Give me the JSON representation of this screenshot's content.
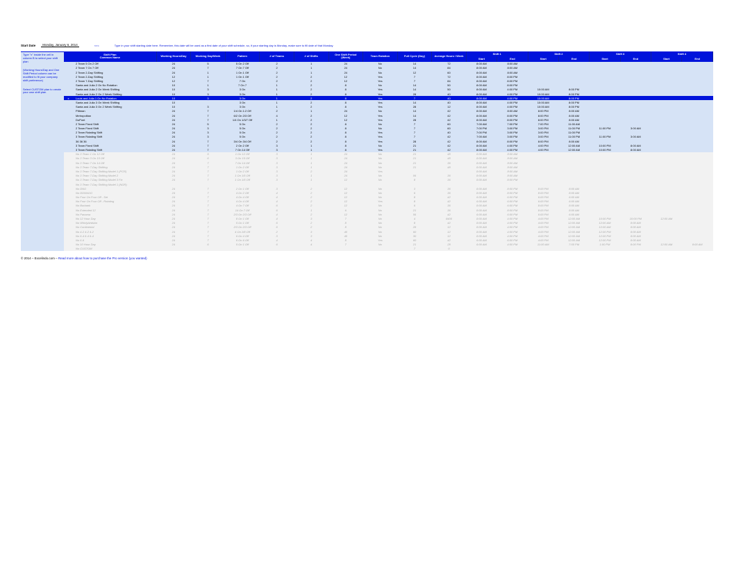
{
  "top": {
    "start_label": "Start Date",
    "start_date": "Monday, January 6, 2014",
    "arrow": "<<<",
    "note": "Type in your shift starting date here. Remember, this date will be used as a first date of your shift schedule, so, if your starting day is Monday, make sure to fill date of that Monday."
  },
  "headers": {
    "shift_plan": "Shift Plan",
    "common_name": "Common Name",
    "working_hours_day": "Working Hours/Day",
    "working_day_week": "Working Day/Week",
    "pattern": "Pattern",
    "no_teams": "# of Teams",
    "no_shifts": "# of Shifts",
    "one_shift_period": "One Shift Period (Week)",
    "team_rotation": "Team Rotation",
    "full_cycle": "Full Cycle (Day)",
    "avg_hours_week": "Average Hours / Week",
    "shift1": "Shift 1",
    "shift2": "Shift 2",
    "shift3": "Shift 3",
    "shift4": "Shift 4",
    "start": "Start",
    "end": "End"
  },
  "sidebar": {
    "note1": "Type \"x\" inside the cell in column B to select your shift plan",
    "note2": "(Working Hours/Day and One Shift Period column can be modified to fit your company shift preference)",
    "note3": "Select CUSTOM plan to create your own shift plan"
  },
  "rows": [
    {
      "sel": "",
      "name": "2 Team 5 On 2 Off",
      "whd": "24",
      "wdw": "5",
      "pat": "5 On 2 Off",
      "teams": "2",
      "shifts": "1",
      "period": "24",
      "rot": "No",
      "cycle": "14",
      "avg": "72",
      "s": [
        [
          "8:00 AM",
          "8:00 AM"
        ]
      ]
    },
    {
      "sel": "",
      "name": "2 Team 7 On 7 Off",
      "whd": "24",
      "wdw": "7",
      "pat": "7 On 7 Off",
      "teams": "2",
      "shifts": "1",
      "period": "24",
      "rot": "No",
      "cycle": "14",
      "avg": "84",
      "s": [
        [
          "8:00 AM",
          "8:00 AM"
        ]
      ]
    },
    {
      "sel": "",
      "name": "2 Team 2-Day Shifting",
      "whd": "24",
      "wdw": "1",
      "pat": "1 On 1 Off",
      "teams": "2",
      "shifts": "1",
      "period": "24",
      "rot": "No",
      "cycle": "12",
      "avg": "60",
      "s": [
        [
          "8:00 AM",
          "8:00 AM"
        ]
      ]
    },
    {
      "sel": "",
      "name": "2 Team 2-Day Shifting",
      "whd": "12",
      "wdw": "1",
      "pat": "1 On 1 Off",
      "teams": "2",
      "shifts": "2",
      "period": "12",
      "rot": "Yes",
      "cycle": "7",
      "avg": "72",
      "s": [
        [
          "8:00 AM",
          "8:00 PM"
        ]
      ]
    },
    {
      "sel": "",
      "name": "2 Team 7-Day Shifting",
      "whd": "12",
      "wdw": "7",
      "pat": "7 On",
      "teams": "2",
      "shifts": "2",
      "period": "12",
      "rot": "Yes",
      "cycle": "7",
      "avg": "84",
      "s": [
        [
          "8:00 AM",
          "8:00 PM"
        ]
      ]
    },
    {
      "sel": "",
      "name": "Santa and Julia 2 On No Rotation",
      "whd": "10",
      "wdw": "1",
      "pat": "7 On 7",
      "teams": "1",
      "shifts": "2",
      "period": "8",
      "rot": "No",
      "cycle": "14",
      "avg": "50",
      "s": [
        [
          "8:00 AM",
          "8:00 PM"
        ]
      ]
    },
    {
      "sel": "",
      "name": "Santa and Julia 2 On Week Shifting",
      "whd": "10",
      "wdw": "3",
      "pat": "3 On",
      "teams": "1",
      "shifts": "2",
      "period": "8",
      "rot": "Yes",
      "cycle": "14",
      "avg": "50",
      "s": [
        [
          "8:00 AM",
          "4:00 PM"
        ],
        [
          "10:00 AM",
          "8:00 PM"
        ]
      ]
    },
    {
      "sel": "",
      "name": "Santa and Julia 2 On 2 Week Shifting",
      "whd": "10",
      "wdw": "3",
      "pat": "3 On",
      "teams": "1",
      "shifts": "2",
      "period": "8",
      "rot": "Yes",
      "cycle": "28",
      "avg": "40",
      "s": [
        [
          "8:00 AM",
          "4:00 PM"
        ],
        [
          "10:00 AM",
          "8:00 PM"
        ]
      ]
    },
    {
      "sel": "x",
      "name": "Louis and Julia 1 On No Rotation",
      "whd": "10",
      "wdw": "3",
      "pat": "3 On",
      "teams": "1",
      "shifts": "2",
      "period": "8",
      "rot": "Yes",
      "cycle": "7",
      "avg": "40",
      "s": [
        [
          "8:00 AM",
          "4:00 PM"
        ],
        [
          "10:00 AM",
          "8:00 PM"
        ]
      ],
      "selected": true
    },
    {
      "sel": "",
      "name": "Santa and Julia 3 On Week Shifting",
      "whd": "10",
      "wdw": "",
      "pat": "3 On",
      "teams": "1",
      "shifts": "2",
      "period": "8",
      "rot": "Yes",
      "cycle": "14",
      "avg": "40",
      "s": [
        [
          "8:00 AM",
          "4:00 PM"
        ],
        [
          "10:00 AM",
          "8:00 PM"
        ]
      ]
    },
    {
      "sel": "",
      "name": "Santa and Julia 3 On 2 Week Shifting",
      "whd": "10",
      "wdw": "3",
      "pat": "3 On",
      "teams": "1",
      "shifts": "2",
      "period": "8",
      "rot": "Yes",
      "cycle": "28",
      "avg": "12",
      "s": [
        [
          "8:00 AM",
          "4:00 PM"
        ],
        [
          "10:00 AM",
          "8:00 PM"
        ]
      ]
    },
    {
      "sel": "",
      "name": "Pittman",
      "whd": "24",
      "wdw": "7",
      "pat": "1/4 On 1:2 Off",
      "teams": "2",
      "shifts": "1",
      "period": "24",
      "rot": "No",
      "cycle": "14",
      "avg": "42",
      "s": [
        [
          "8:00 AM",
          "8:00 AM"
        ],
        [
          "8:00 PM",
          "8:00 AM"
        ]
      ]
    },
    {
      "sel": "",
      "name": "Metropolitan",
      "whd": "24",
      "wdw": "7",
      "pat": "6/2 On 2/3 Off",
      "teams": "4",
      "shifts": "2",
      "period": "12",
      "rot": "Yes",
      "cycle": "14",
      "avg": "42",
      "s": [
        [
          "8:00 AM",
          "8:00 PM"
        ],
        [
          "8:00 PM",
          "8:00 AM"
        ]
      ]
    },
    {
      "sel": "",
      "name": "DuPont",
      "whd": "24",
      "wdw": "7",
      "pat": "1/4 On 1/3/7 Off",
      "teams": "1",
      "shifts": "2",
      "period": "12",
      "rot": "Yes",
      "cycle": "28",
      "avg": "42",
      "s": [
        [
          "8:00 AM",
          "8:00 PM"
        ],
        [
          "8:00 PM",
          "8:00 AM"
        ]
      ]
    },
    {
      "sel": "",
      "name": "2 Team Fixed Shift",
      "whd": "24",
      "wdw": "5",
      "pat": "5 On",
      "teams": "2",
      "shifts": "2",
      "period": "8",
      "rot": "No",
      "cycle": "7",
      "avg": "60",
      "s": [
        [
          "7:00 AM",
          "7:00 PM"
        ],
        [
          "7:00 PM",
          "11:00 AM"
        ]
      ]
    },
    {
      "sel": "",
      "name": "2 Team Fixed Shift",
      "whd": "24",
      "wdw": "3",
      "pat": "5 On",
      "teams": "2",
      "shifts": "2",
      "period": "8",
      "rot": "No",
      "cycle": "7",
      "avg": "60",
      "s": [
        [
          "7:00 PM",
          "3:00 PM"
        ],
        [
          "3:00 PM",
          "11:00 PM"
        ],
        [
          "11:00 PM",
          "3:00 AM"
        ]
      ]
    },
    {
      "sel": "",
      "name": "2 Team Rotating Shift",
      "whd": "24",
      "wdw": "3",
      "pat": "5 On",
      "teams": "2",
      "shifts": "2",
      "period": "8",
      "rot": "Yes",
      "cycle": "7",
      "avg": "40",
      "s": [
        [
          "7:00 PM",
          "3:00 PM"
        ],
        [
          "3:00 PM",
          "11:00 PM"
        ]
      ]
    },
    {
      "sel": "",
      "name": "3 Team Rotating Shift",
      "whd": "24",
      "wdw": "3",
      "pat": "5 On",
      "teams": "2",
      "shifts": "2",
      "period": "8",
      "rot": "Yes",
      "cycle": "7",
      "avg": "42",
      "s": [
        [
          "7:00 AM",
          "3:00 PM"
        ],
        [
          "3:00 PM",
          "11:00 PM"
        ],
        [
          "11:00 PM",
          "3:00 AM"
        ]
      ]
    },
    {
      "sel": "",
      "name": "36 36 36",
      "whd": "24",
      "wdw": "7",
      "pat": "3/4 On 3/4 Off",
      "teams": "2",
      "shifts": "2",
      "period": "8",
      "rot": "Yes",
      "cycle": "28",
      "avg": "42",
      "s": [
        [
          "8:00 AM",
          "8:00 PM"
        ],
        [
          "8:00 PM",
          "8:00 AM"
        ]
      ]
    },
    {
      "sel": "",
      "name": "3 Team Fixed Shift",
      "whd": "24",
      "wdw": "7",
      "pat": "2 On 2 Off",
      "teams": "3",
      "shifts": "1",
      "period": "8",
      "rot": "No",
      "cycle": "21",
      "avg": "42",
      "s": [
        [
          "8:00 AM",
          "4:00 PM"
        ],
        [
          "4:00 PM",
          "12:00 AM"
        ],
        [
          "10:00 PM",
          "8:00 AM"
        ]
      ]
    },
    {
      "sel": "",
      "name": "3 Team Rotating Shift",
      "whd": "24",
      "wdw": "7",
      "pat": "7 On 14 Off",
      "teams": "3",
      "shifts": "1",
      "period": "8",
      "rot": "Yes",
      "cycle": "21",
      "avg": "42",
      "s": [
        [
          "8:00 AM",
          "4:00 PM"
        ],
        [
          "4:00 PM",
          "12:00 AM"
        ],
        [
          "10:00 PM",
          "8:00 AM"
        ]
      ]
    }
  ],
  "inactive_rows": [
    {
      "name": "No  3 Team 1 On 12 Off",
      "whd": "24",
      "wdw": "5",
      "pat": "1 On 12 Off",
      "teams": "3",
      "shifts": "1",
      "period": "24",
      "rot": "No",
      "cycle": "21",
      "avg": "48",
      "s": [
        [
          "8:00 AM",
          "8:00 AM"
        ]
      ]
    },
    {
      "name": "No  3 Team 3 On 15 Off",
      "whd": "24",
      "wdw": "6",
      "pat": "3 On 15 Off",
      "teams": "3",
      "shifts": "1",
      "period": "24",
      "rot": "No",
      "cycle": "21",
      "avg": "48",
      "s": [
        [
          "8:00 AM",
          "8:00 AM"
        ]
      ]
    },
    {
      "name": "No  3 Team 7 On 14 Off",
      "whd": "24",
      "wdw": "7",
      "pat": "7 On 14 Off",
      "teams": "3",
      "shifts": "1",
      "period": "24",
      "rot": "No",
      "cycle": "21",
      "avg": "36",
      "s": [
        [
          "8:00 AM",
          "8:00 AM"
        ]
      ]
    },
    {
      "name": "No  3 Team 7-Day Shifting",
      "whd": "24",
      "wdw": "7",
      "pat": "1 On 2 Off",
      "teams": "3",
      "shifts": "1",
      "period": "24",
      "rot": "No",
      "cycle": "21",
      "avg": "48",
      "s": [
        [
          "8:00 AM",
          "8:00 AM"
        ]
      ]
    },
    {
      "name": "No  3 Team 7-Day Shifting Model 1 (PCR)",
      "whd": "24",
      "wdw": "7",
      "pat": "1 On 2 Off",
      "teams": "3",
      "shifts": "2",
      "period": "24",
      "rot": "Yes",
      "cycle": "",
      "avg": "",
      "s": [
        [
          "8:00 AM",
          "8:00 AM"
        ]
      ]
    },
    {
      "name": "No  3 Team 7-Day Shifting Model 2",
      "whd": "24",
      "wdw": "7",
      "pat": "1 On 1/5 Off",
      "teams": "3",
      "shifts": "1",
      "period": "24",
      "rot": "No",
      "cycle": "06",
      "avg": "36",
      "s": [
        [
          "8:00 AM",
          "8:00 AM"
        ]
      ]
    },
    {
      "name": "No  3 Team 7-Day Shifting Model 3 Fix",
      "whd": "24",
      "wdw": "7",
      "pat": "1 On 1/5 Off",
      "teams": "3",
      "shifts": "1",
      "period": "12",
      "rot": "No",
      "cycle": "8",
      "avg": "36",
      "s": [
        [
          "8:00 AM",
          "8:00 PM"
        ]
      ]
    },
    {
      "name": "No  3 Team 7-Day Shifting Model 1 (NGR)",
      "whd": "",
      "wdw": "",
      "pat": "",
      "teams": "",
      "shifts": "",
      "period": "",
      "rot": "",
      "cycle": "",
      "avg": "",
      "s": [
        []
      ]
    },
    {
      "name": "No  DNO",
      "whd": "24",
      "wdw": "7",
      "pat": "2 On 1 Off",
      "teams": "3",
      "shifts": "2",
      "period": "12",
      "rot": "No",
      "cycle": "3",
      "avg": "36",
      "s": [
        [
          "8:00 AM",
          "8:00 PM"
        ],
        [
          "8:00 PM",
          "8:00 AM"
        ]
      ]
    },
    {
      "name": "No  DDNNOO",
      "whd": "24",
      "wdw": "7",
      "pat": "4 On 2 Off",
      "teams": "4",
      "shifts": "2",
      "period": "12",
      "rot": "No",
      "cycle": "6",
      "avg": "36",
      "s": [
        [
          "8:00 AM",
          "8:00 PM"
        ],
        [
          "8:00 PM",
          "8:00 AM"
        ]
      ]
    },
    {
      "name": "No   Four On Four Off - Set",
      "whd": "24",
      "wdw": "7",
      "pat": "4 On 4 Off",
      "teams": "4",
      "shifts": "2",
      "period": "12",
      "rot": "No",
      "cycle": "8",
      "avg": "42",
      "s": [
        [
          "6:00 AM",
          "6:00 PM"
        ],
        [
          "6:00 PM",
          "6:00 AM"
        ]
      ]
    },
    {
      "name": "No   Four On Four Off - Rotating",
      "whd": "24",
      "wdw": "7",
      "pat": "4 On 4 Off",
      "teams": "4",
      "shifts": "2",
      "period": "12",
      "rot": "Yes",
      "cycle": "8",
      "avg": "42",
      "s": [
        [
          "6:00 AM",
          "6:00 PM"
        ],
        [
          "6:00 PM",
          "6:00 AM"
        ]
      ]
    },
    {
      "name": "No   Burbank",
      "whd": "24",
      "wdw": "7",
      "pat": "4 On 7 Off",
      "teams": "6",
      "shifts": "2",
      "period": "12",
      "rot": "No",
      "cycle": "6",
      "avg": "36",
      "s": [
        [
          "8:00 AM",
          "6:00 PM"
        ],
        [
          "8:00 PM",
          "8:00 AM"
        ]
      ]
    },
    {
      "name": "No   Extended 12",
      "whd": "24",
      "wdw": "7",
      "pat": "14 On 7 Off",
      "teams": "6",
      "shifts": "1",
      "period": "6",
      "rot": "No",
      "cycle": "21",
      "avg": "36",
      "s": [
        [
          "8:00 AM",
          "8:00 PM"
        ],
        [
          "8:00 PM",
          "8:00 AM"
        ]
      ]
    },
    {
      "name": "No   Panama",
      "whd": "24",
      "wdw": "7",
      "pat": "2/3 On 2/3 Off",
      "teams": "4",
      "shifts": "2",
      "period": "12",
      "rot": "No",
      "cycle": "56",
      "avg": "42",
      "s": [
        [
          "6:00 AM",
          "6:00 PM"
        ],
        [
          "6:00 PM",
          "6:00 AM"
        ]
      ]
    },
    {
      "name": "No   12 Hour Day",
      "whd": "24",
      "wdw": "7",
      "pat": "8 On 1 Off",
      "teams": "4",
      "shifts": "3",
      "period": "7",
      "rot": "No",
      "cycle": "4",
      "avg": "8400",
      "s": [
        [
          "8:00 AM",
          "4:00 PM"
        ],
        [
          "4:00 PM",
          "12:00 AM"
        ],
        [
          "10:00 PM",
          "10:00 PM"
        ],
        [
          "12:00 AM",
          ""
        ]
      ]
    },
    {
      "name": "No   Whirlybirdskin",
      "whd": "24",
      "wdw": "7",
      "pat": "5 On 1 Off",
      "teams": "6",
      "shifts": "2",
      "period": "8",
      "rot": "No",
      "cycle": "8",
      "avg": "42",
      "s": [
        [
          "8:00 AM",
          "4:00 PM"
        ],
        [
          "4:00 PM",
          "12:00 AM"
        ],
        [
          "12:00 AM",
          "8:00 AM"
        ]
      ]
    },
    {
      "name": "No   Continental",
      "whd": "24",
      "wdw": "7",
      "pat": "2/3 On 2/3 Off",
      "teams": "6",
      "shifts": "2",
      "period": "8",
      "rot": "No",
      "cycle": "28",
      "avg": "12",
      "s": [
        [
          "8:00 AM",
          "4:00 PM"
        ],
        [
          "4:00 PM",
          "12:00 AM"
        ],
        [
          "12:00 AM",
          "8:00 AM"
        ]
      ]
    },
    {
      "name": "No   4-2 4-2 4-2",
      "whd": "24",
      "wdw": "7",
      "pat": "4 On 2/8 Off",
      "teams": "2",
      "shifts": "3",
      "period": "40",
      "rot": "No",
      "cycle": "60",
      "avg": "12",
      "s": [
        [
          "8:00 AM",
          "4:00 PM"
        ],
        [
          "4:00 PM",
          "12:00 AM"
        ],
        [
          "12:00 PM",
          "8:00 AM"
        ]
      ]
    },
    {
      "name": "No   6-4 6-4 6-4",
      "whd": "24",
      "wdw": "7",
      "pat": "6 On 4 Off",
      "teams": "3",
      "shifts": "3",
      "period": "40",
      "rot": "No",
      "cycle": "30",
      "avg": "12",
      "s": [
        [
          "8:00 AM",
          "4:00 PM"
        ],
        [
          "4:00 PM",
          "12:00 AM"
        ],
        [
          "12:00 PM",
          "8:00 AM"
        ]
      ]
    },
    {
      "name": "No   6-6",
      "whd": "24",
      "wdw": "7",
      "pat": "6 On 6 Off",
      "teams": "4",
      "shifts": "4",
      "period": "8",
      "rot": "Yes",
      "cycle": "60",
      "avg": "42",
      "s": [
        [
          "6:00 AM",
          "6:00 PM"
        ],
        [
          "4:00 PM",
          "12:00 AM"
        ],
        [
          "12:00 PM",
          "8:00 AM"
        ]
      ]
    },
    {
      "name": "No   10 Hour Day",
      "whd": "24",
      "wdw": "6",
      "pat": "5 On 1 Off",
      "teams": "6",
      "shifts": "4",
      "period": "7",
      "rot": "No",
      "cycle": "21",
      "avg": "28",
      "s": [
        [
          "6:00 AM",
          "4:00 PM"
        ],
        [
          "11:00 AM",
          "7:00 PM"
        ],
        [
          "1:00 PM",
          "8:00 PM"
        ],
        [
          "12:00 AM",
          "8:00 AM"
        ]
      ]
    },
    {
      "name": "No   CUSTOM",
      "whd": "",
      "wdw": "",
      "pat": "",
      "teams": "",
      "shifts": "",
      "period": "",
      "rot": "",
      "cycle": "7",
      "avg": "0",
      "s": [
        []
      ]
    }
  ],
  "footer": {
    "copyright": "© 2014 – Excelindo.com – ",
    "link": "Read more about how to purchase the Pro version (you wanted)"
  }
}
